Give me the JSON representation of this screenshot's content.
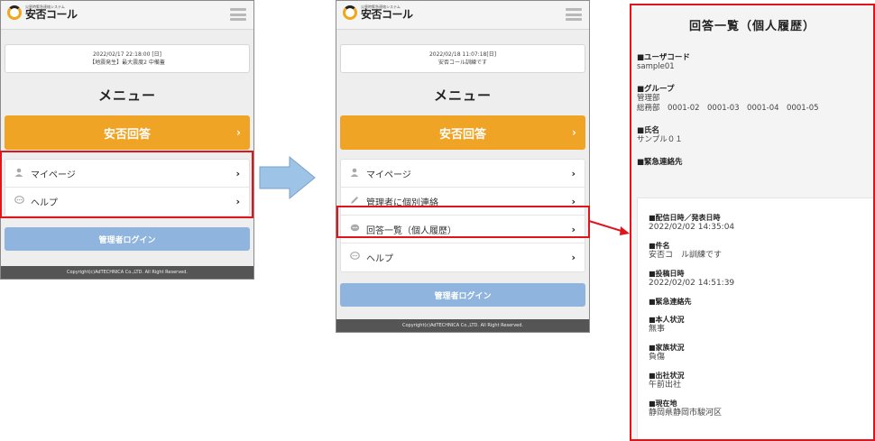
{
  "app": {
    "logo_subtext": "災害時緊急連絡システム",
    "logo_text": "安否コール"
  },
  "phone1": {
    "notice_line1": "2022/02/17 22:18:00 [日]",
    "notice_line2": "【地震発生】最大震度2 中備蓋",
    "menu_title": "メニュー",
    "answer_button": "安否回答",
    "items": [
      {
        "icon": "person-icon",
        "label": "マイページ"
      },
      {
        "icon": "chat-icon",
        "label": "ヘルプ"
      }
    ],
    "admin_button": "管理者ログイン",
    "footer": "Copyright(c)AdTECHNICA Co.,LTD. All Right Reserved."
  },
  "phone2": {
    "notice_line1": "2022/02/18 11:07:18[日]",
    "notice_line2": "安否コール訓練です",
    "menu_title": "メニュー",
    "answer_button": "安否回答",
    "items": [
      {
        "icon": "person-icon",
        "label": "マイページ"
      },
      {
        "icon": "pencil-icon",
        "label": "管理者に個別連絡"
      },
      {
        "icon": "chat-icon",
        "label": "回答一覧（個人履歴）"
      },
      {
        "icon": "chat-icon",
        "label": "ヘルプ"
      }
    ],
    "admin_button": "管理者ログイン",
    "footer": "Copyright(c)AdTECHNICA Co.,LTD. All Right Reserved."
  },
  "history": {
    "title": "回答一覧（個人履歴）",
    "top_fields": [
      {
        "label": "■ユーザコード",
        "value": "sample01"
      },
      {
        "label": "■グループ",
        "value": "管理部",
        "value2": "総務部　0001-02　0001-03　0001-04　0001-05"
      },
      {
        "label": "■氏名",
        "value": "サンプル０１"
      },
      {
        "label": "■緊急連絡先",
        "value": ""
      }
    ],
    "bottom_fields": [
      {
        "label": "■配信日時／発表日時",
        "value": "2022/02/02 14:35:04"
      },
      {
        "label": "■件名",
        "value": "安否コ　ル訓練です"
      },
      {
        "label": "■投稿日時",
        "value": "2022/02/02 14:51:39"
      },
      {
        "label": "■緊急連絡先",
        "value": ""
      },
      {
        "label": "■本人状況",
        "value": "無事"
      },
      {
        "label": "■家族状況",
        "value": "負傷"
      },
      {
        "label": "■出社状況",
        "value": "午前出社"
      },
      {
        "label": "■現在地",
        "value": "静岡県静岡市駿河区"
      }
    ]
  },
  "colors": {
    "accent_orange": "#f0a425",
    "admin_blue": "#8fb4dd",
    "highlight_red": "#e0141b",
    "arrow_blue": "#9dc3e6"
  }
}
